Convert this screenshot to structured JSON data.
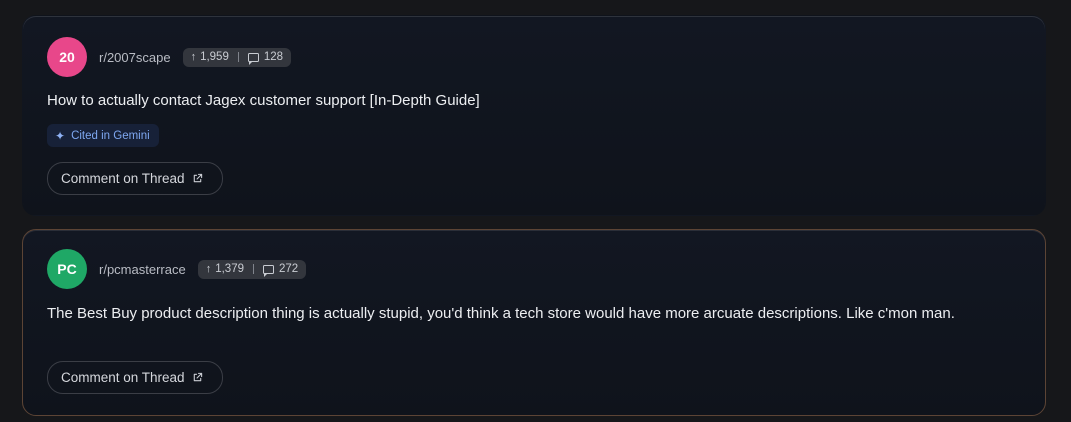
{
  "threads": [
    {
      "avatar_text": "20",
      "avatar_color": "#e8478a",
      "subreddit": "r/2007scape",
      "upvotes": "1,959",
      "comments": "128",
      "title": "How to actually contact Jagex customer support [In-Depth Guide]",
      "badge": "Cited in Gemini",
      "comment_button": "Comment on Thread"
    },
    {
      "avatar_text": "PC",
      "avatar_color": "#1fa866",
      "subreddit": "r/pcmasterrace",
      "upvotes": "1,379",
      "comments": "272",
      "title": "The Best Buy product description thing is actually stupid, you'd think a tech store would have more arcuate descriptions. Like c'mon man.",
      "comment_button": "Comment on Thread"
    }
  ],
  "icons": {
    "upvote": "arrow-up-icon",
    "comments": "comment-bubble-icon",
    "badge": "sparkle-icon",
    "external": "external-link-icon"
  },
  "colors": {
    "card_highlight_border": "#5c4435",
    "badge_text": "#7ea7f0"
  }
}
